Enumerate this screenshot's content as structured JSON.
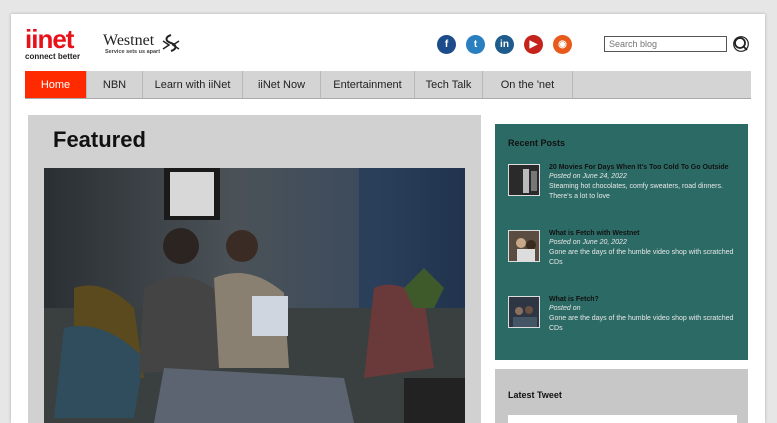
{
  "header": {
    "iinet_logo_text": "iinet",
    "iinet_tagline": "connect better",
    "westnet_logo_text": "Westnet",
    "westnet_tagline": "Service sets us apart",
    "social": [
      {
        "icon": "facebook-icon",
        "glyph": "f",
        "color": "#1c4c8a"
      },
      {
        "icon": "twitter-icon",
        "glyph": "t",
        "color": "#2a7fc1"
      },
      {
        "icon": "linkedin-icon",
        "glyph": "in",
        "color": "#1d5c8c"
      },
      {
        "icon": "youtube-icon",
        "glyph": "▶",
        "color": "#c4221a"
      },
      {
        "icon": "rss-icon",
        "glyph": "◉",
        "color": "#e85a1b"
      }
    ],
    "search_placeholder": "Search blog"
  },
  "nav": {
    "items": [
      {
        "label": "Home",
        "active": true
      },
      {
        "label": "NBN",
        "active": false
      },
      {
        "label": "Learn with iiNet",
        "active": false
      },
      {
        "label": "iiNet Now",
        "active": false
      },
      {
        "label": "Entertainment",
        "active": false
      },
      {
        "label": "Tech Talk",
        "active": false
      },
      {
        "label": "On the 'net",
        "active": false
      }
    ],
    "active_color": "#ff2a00"
  },
  "featured": {
    "title": "Featured"
  },
  "recent_posts": {
    "title": "Recent Posts",
    "panel_color": "#2c6b65",
    "posts": [
      {
        "title": "20 Movies For Days When It's Too Cold To Go Outside",
        "date": "Posted on June 24, 2022",
        "description": "Steaming hot chocolates, comfy sweaters, road dinners. There's a lot to love"
      },
      {
        "title": "What is Fetch with Westnet",
        "date": "Posted on June 20, 2022",
        "description": "Gone are the days of the humble video shop with scratched CDs"
      },
      {
        "title": "What is Fetch?",
        "date": "Posted on",
        "description": "Gone are the days of the humble video shop with scratched CDs"
      }
    ]
  },
  "latest_tweet": {
    "title": "Latest Tweet"
  }
}
